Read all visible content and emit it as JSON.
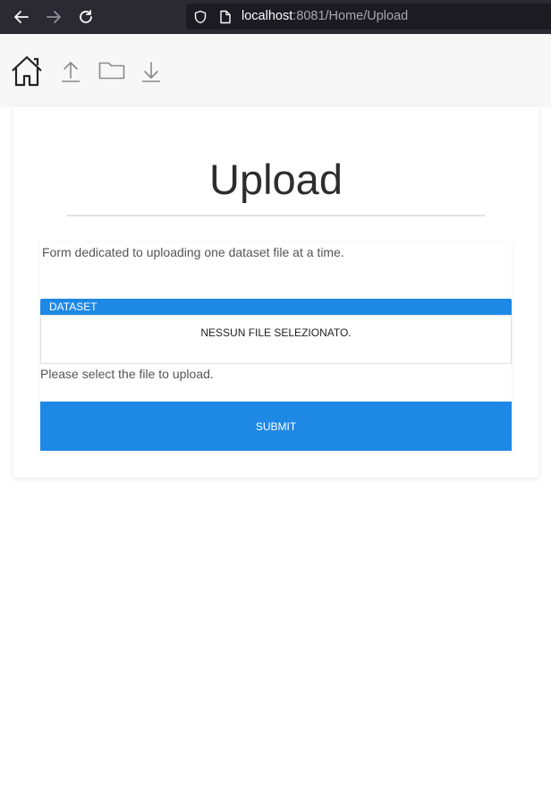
{
  "browser": {
    "url_host": "localhost",
    "url_rest": ":8081/Home/Upload",
    "icons": [
      "back-arrow-icon",
      "forward-arrow-icon",
      "reload-icon",
      "shield-icon",
      "page-icon"
    ]
  },
  "toolbar": {
    "icons": [
      "home-icon",
      "upload-icon",
      "folder-icon",
      "download-icon"
    ]
  },
  "page": {
    "title": "Upload",
    "description": "Form dedicated to uploading one dataset file at a time.",
    "field_label": "DATASET",
    "file_status": "NESSUN FILE SELEZIONATO.",
    "help_text": "Please select the file to upload.",
    "submit_label": "SUBMIT"
  },
  "colors": {
    "accent": "#1e88e5",
    "chrome": "#2b2a33",
    "toolbar_bg": "#f7f7f7"
  }
}
